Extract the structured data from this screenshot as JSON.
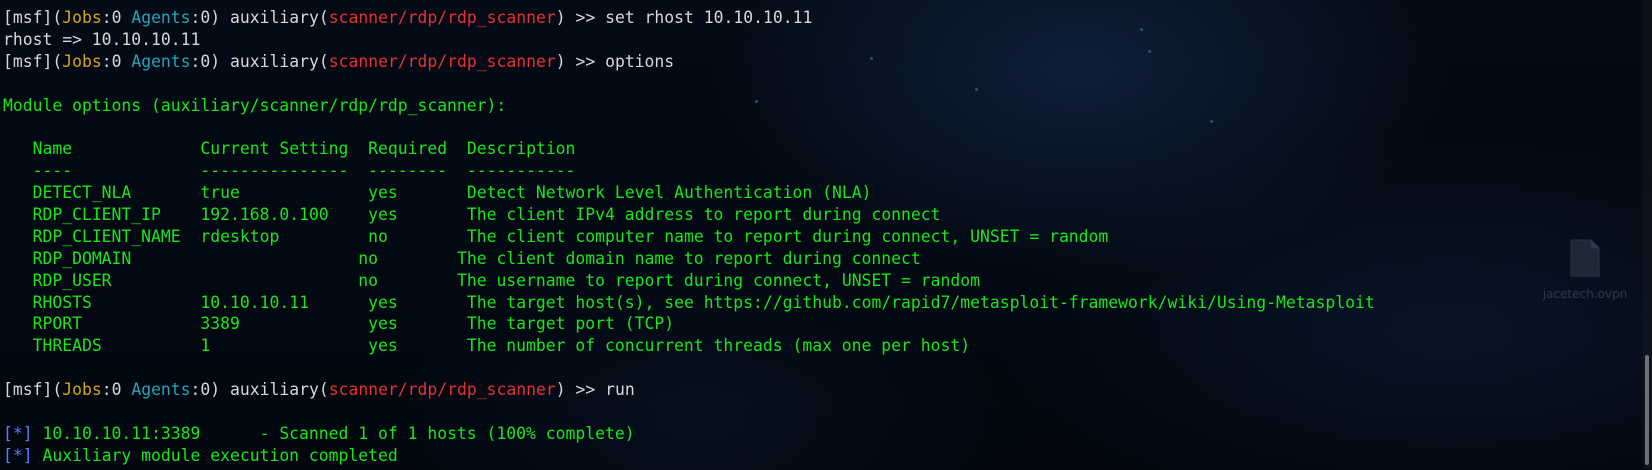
{
  "terminal": {
    "prompt": {
      "msf": "[msf]",
      "jobs_open": "(",
      "jobs_label": "Jobs",
      "jobs_sep": ":",
      "jobs_value": "0",
      "agents_label": "Agents",
      "agents_sep": ":",
      "agents_value": "0",
      "agents_close": ")",
      "module_type": "auxiliary",
      "module_paren_open": "(",
      "module_path": "scanner/rdp/rdp_scanner",
      "module_paren_close": ")",
      "arrow": ">>"
    },
    "cmd1": "set rhost 10.10.10.11",
    "out1": "rhost => 10.10.10.11",
    "cmd2": "options",
    "module_options_title": "Module options (auxiliary/scanner/rdp/rdp_scanner):",
    "table": {
      "headers": [
        "Name",
        "Current Setting",
        "Required",
        "Description"
      ],
      "underlines": [
        "----",
        "---------------",
        "--------",
        "-----------"
      ],
      "rows": [
        [
          "DETECT_NLA",
          "true",
          "yes",
          "Detect Network Level Authentication (NLA)"
        ],
        [
          "RDP_CLIENT_IP",
          "192.168.0.100",
          "yes",
          "The client IPv4 address to report during connect"
        ],
        [
          "RDP_CLIENT_NAME",
          "rdesktop",
          "no",
          "The client computer name to report during connect, UNSET = random"
        ],
        [
          "RDP_DOMAIN",
          "",
          "no",
          "The client domain name to report during connect"
        ],
        [
          "RDP_USER",
          "",
          "no",
          "The username to report during connect, UNSET = random"
        ],
        [
          "RHOSTS",
          "10.10.10.11",
          "yes",
          "The target host(s), see https://github.com/rapid7/metasploit-framework/wiki/Using-Metasploit"
        ],
        [
          "RPORT",
          "3389",
          "yes",
          "The target port (TCP)"
        ],
        [
          "THREADS",
          "1",
          "yes",
          "The number of concurrent threads (max one per host)"
        ]
      ]
    },
    "cmd3": "run",
    "status_marker": "[*]",
    "out_scan": "10.10.10.11:3389      - Scanned 1 of 1 hosts (100% complete)",
    "out_done": "Auxiliary module execution completed"
  },
  "desktop": {
    "watermark_label": "jacetech.ovpn",
    "watermark_icon": "file-icon"
  },
  "colors": {
    "background": "#030912",
    "green": "#19e619",
    "yellow": "#d6a11e",
    "cyan": "#2aa3b8",
    "red": "#e83030",
    "blue": "#5a7cff",
    "white": "#d8d8d8"
  }
}
